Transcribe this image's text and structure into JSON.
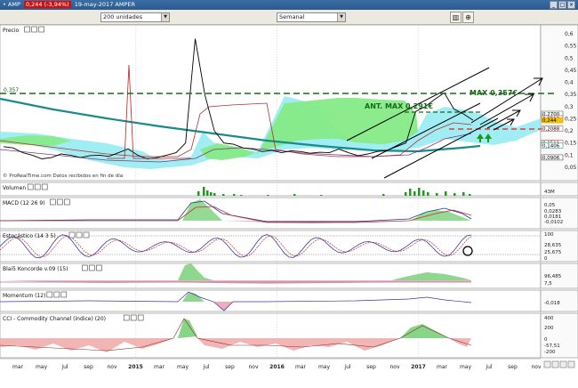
{
  "window": {
    "ticker_prefix": "• AMP",
    "price_badge": "0,244 (-3,94%)",
    "date": "19-may-2017",
    "name": "AMPER"
  },
  "toolbar": {
    "units_select": "200 unidades",
    "period_select": "Semanal"
  },
  "panels": {
    "price": "Precio",
    "source": "© ProRealTime.com  Datos recibidos en fin de día",
    "volume": "Volumen",
    "macd": "MACD (12 26 9)",
    "stochastic": "Estocástico (14 3 5)",
    "blai5": "Blai5 Koncorde v.09 (15)",
    "momentum": "Momentum (12)",
    "cci": "CCI - Commodity Channel (índice) (20)"
  },
  "annotations": {
    "left_level": "0,357",
    "max_label": "MAX 0,357€",
    "ant_max_label": "ANT. MAX 0,291€"
  },
  "colors": {
    "ma_long": "#1a8a8a",
    "cloud_green": "#7ee87e",
    "cloud_cyan": "#7fe6f0",
    "dashed_green": "#1a6a1a",
    "dashed_red": "#e02020",
    "volume": "#1f9a1f",
    "price_candle": "#000000"
  },
  "chart_data": {
    "type": "line",
    "x_ticks": [
      "mar",
      "may",
      "jul",
      "sep",
      "nov",
      "2015",
      "mar",
      "may",
      "jul",
      "sep",
      "nov",
      "2016",
      "mar",
      "may",
      "jul",
      "sep",
      "nov",
      "2017",
      "mar",
      "may",
      "jul",
      "sep",
      "nov"
    ],
    "price_axis": {
      "ticks": [
        "0,6",
        "0,55",
        "0,5",
        "0,45",
        "0,4",
        "0,35",
        "0,3",
        "0,25",
        "0,2",
        "0,15",
        "0,1",
        "0,05"
      ],
      "markers": [
        "0,2700",
        "0,2518",
        "0,244",
        "0,2088",
        "0,1511",
        "0,1406",
        "0,0906"
      ]
    },
    "volume_axis": {
      "ticks": [
        "43M"
      ]
    },
    "macd_axis": {
      "ticks": [
        "0,05",
        "0,0283",
        "0,0181",
        "-0,0102"
      ]
    },
    "stochastic_axis": {
      "ticks": [
        "100",
        "28,635",
        "25,675",
        "0"
      ]
    },
    "blai5_axis": {
      "ticks": [
        "96,485",
        "7,5"
      ]
    },
    "momentum_axis": {
      "ticks": [
        "-0,018"
      ]
    },
    "cci_axis": {
      "ticks": [
        "400",
        "200",
        "0",
        "-57,51",
        "-200"
      ]
    },
    "series": [
      {
        "values": [
          0.135,
          0.13,
          0.11,
          0.1,
          0.085,
          0.09,
          0.105,
          0.1,
          0.09,
          0.098,
          0.1,
          0.095,
          0.11,
          0.125,
          0.1,
          0.085,
          0.09,
          0.1,
          0.11,
          0.15,
          0.58,
          0.35,
          0.2,
          0.15,
          0.145,
          0.13,
          0.125,
          0.115,
          0.12,
          0.11,
          0.118,
          0.115,
          0.108,
          0.112,
          0.11,
          0.125,
          0.11,
          0.098,
          0.105,
          0.115,
          0.12,
          0.135,
          0.15,
          0.28,
          0.3,
          0.33,
          0.357,
          0.29,
          0.27,
          0.244
        ]
      }
    ]
  }
}
